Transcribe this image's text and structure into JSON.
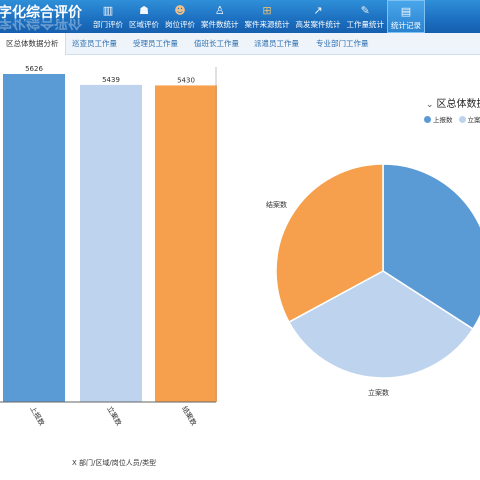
{
  "header": {
    "app_title": "字化综合评价"
  },
  "nav": {
    "items": [
      {
        "label": "部门评价",
        "icon": "book-icon",
        "color": "#f4f7fb"
      },
      {
        "label": "区域评价",
        "icon": "people-icon",
        "color": "#f4f7fb"
      },
      {
        "label": "岗位评价",
        "icon": "person-icon",
        "color": "#f0c08a"
      },
      {
        "label": "案件数统计",
        "icon": "person-tie-icon",
        "color": "#f4f7fb"
      },
      {
        "label": "案件来源统计",
        "icon": "hierarchy-icon",
        "color": "#e8c070"
      },
      {
        "label": "高发案件统计",
        "icon": "trend-icon",
        "color": "#f4f7fb"
      },
      {
        "label": "工作量统计",
        "icon": "tools-icon",
        "color": "#e7eaef"
      },
      {
        "label": "统计记录",
        "icon": "document-icon",
        "color": "#f4f7fb"
      }
    ],
    "active_index": 7
  },
  "tabs": [
    {
      "label": "区总体数据分析"
    },
    {
      "label": "巡查员工作量"
    },
    {
      "label": "受理员工作量"
    },
    {
      "label": "值班长工作量"
    },
    {
      "label": "派遣员工作量"
    },
    {
      "label": "专业部门工作量"
    }
  ],
  "right_panel": {
    "title": "区总体数据",
    "legend": [
      {
        "label": "上报数",
        "color": "#5b9bd5"
      },
      {
        "label": "立案数",
        "color": "#bdd3ee"
      }
    ]
  },
  "chart_data": [
    {
      "type": "bar",
      "categories": [
        "上报数",
        "立案数",
        "结案数"
      ],
      "values": [
        5626,
        5439,
        5430
      ],
      "colors": [
        "#5b9bd5",
        "#bdd3ee",
        "#f6a04d"
      ],
      "xlabel": "X 部门/区域/岗位人员/类型"
    },
    {
      "type": "pie",
      "labels": [
        "上报数",
        "立案数",
        "结案数"
      ],
      "values": [
        5626,
        5439,
        5430
      ],
      "colors": [
        "#5b9bd5",
        "#bdd3ee",
        "#f6a04d"
      ],
      "visible_labels": [
        "结案数",
        "立案数"
      ]
    }
  ]
}
